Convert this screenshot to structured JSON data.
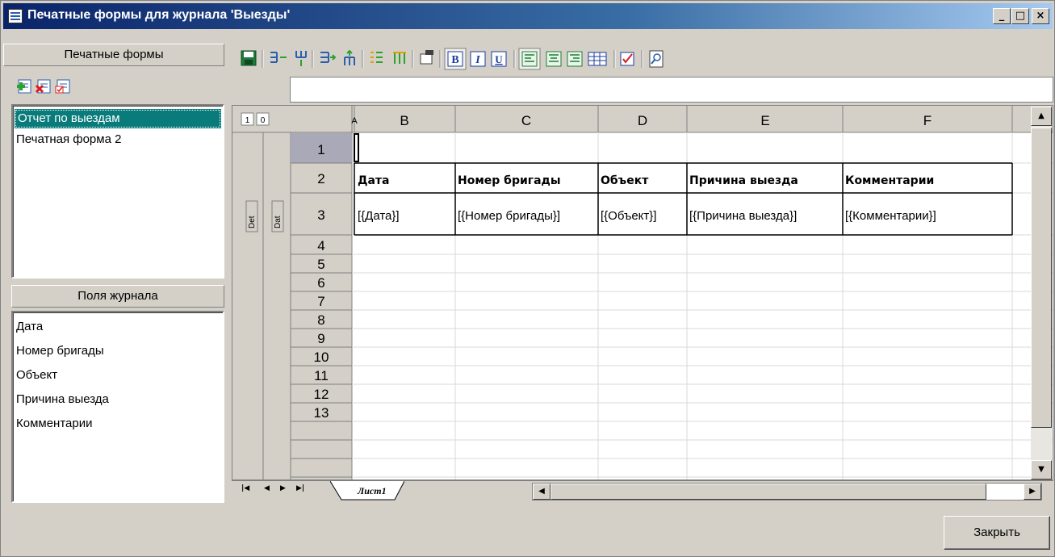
{
  "window": {
    "title": "Печатные формы для журнала 'Выезды'",
    "controls": {
      "minimize": "_",
      "maximize": "□",
      "close": "×"
    }
  },
  "forms_panel": {
    "header": "Печатные формы",
    "toolbar_icons": [
      "add-form-icon",
      "delete-form-icon",
      "edit-form-icon"
    ],
    "items": [
      {
        "label": "Отчет по выездам",
        "selected": true
      },
      {
        "label": "Печатная форма 2",
        "selected": false
      }
    ]
  },
  "fields_panel": {
    "header": "Поля журнала",
    "items": [
      "Дата",
      "Номер бригады",
      "Объект",
      "Причина выезда",
      "Комментарии"
    ]
  },
  "toolbar": {
    "icons": [
      "save-icon",
      "insert-column-icon",
      "insert-row-icon",
      "indent-icon",
      "outdent-icon",
      "list-icon",
      "group-icon",
      "format-painter-icon",
      "bold-icon",
      "italic-icon",
      "underline-icon",
      "align-left-icon",
      "align-center-icon",
      "align-right-icon",
      "table-icon",
      "check-icon",
      "preview-icon"
    ],
    "bold_label": "B",
    "italic_label": "I",
    "underline_label": "U"
  },
  "formula_bar": {
    "value": ""
  },
  "grid": {
    "outline_levels": [
      "1",
      "0"
    ],
    "columns": [
      "A",
      "B",
      "C",
      "D",
      "E",
      "F"
    ],
    "rows": [
      "1",
      "2",
      "3",
      "4",
      "5",
      "6",
      "7",
      "8",
      "9",
      "10",
      "11",
      "12",
      "13"
    ],
    "cells": {
      "row2": [
        "",
        "Дата",
        "Номер бригады",
        "Объект",
        "Причина выезда",
        "Комментарии"
      ],
      "row3": [
        "",
        "[{Дата}]",
        "[{Номер бригады}]",
        "[{Объект}]",
        "[{Причина выезда}]",
        "[{Комментарии}]"
      ]
    },
    "band_labels": [
      "Det",
      "Dat"
    ]
  },
  "sheets": {
    "tabs": [
      "Лист1"
    ],
    "active": "Лист1"
  },
  "footer": {
    "close_label": "Закрыть"
  },
  "colors": {
    "titlebar_start": "#0a246a",
    "selection": "#0a7b7b",
    "face": "#d4d0c8"
  }
}
